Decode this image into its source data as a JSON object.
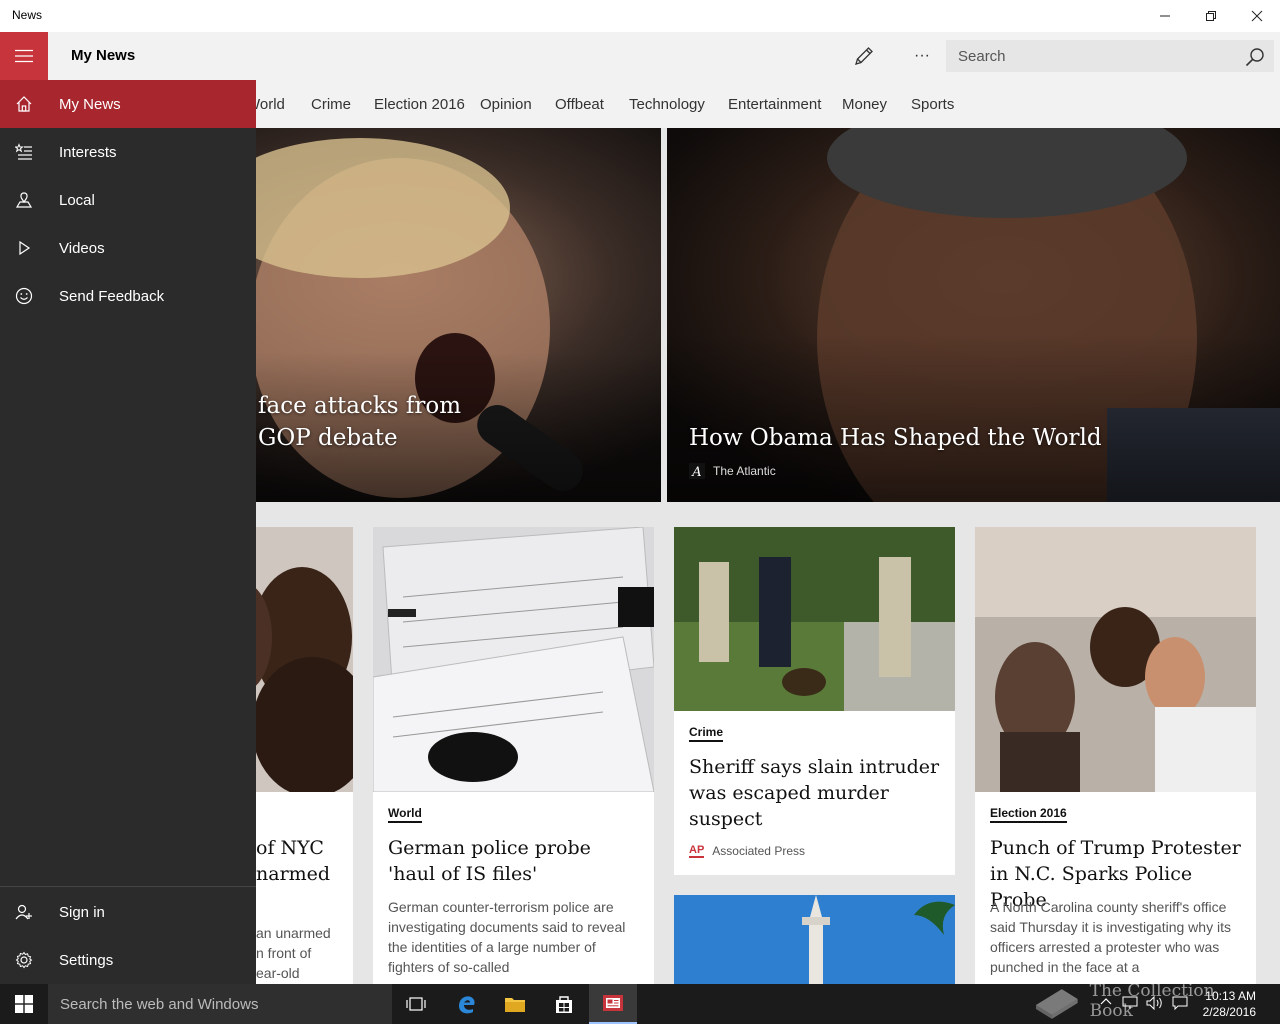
{
  "window": {
    "title": "News"
  },
  "header": {
    "app_title": "My News",
    "search_placeholder": "Search",
    "more_label": "···"
  },
  "tabs": [
    {
      "label": "World"
    },
    {
      "label": "Crime"
    },
    {
      "label": "Election 2016"
    },
    {
      "label": "Opinion"
    },
    {
      "label": "Offbeat"
    },
    {
      "label": "Technology"
    },
    {
      "label": "Entertainment"
    },
    {
      "label": "Money"
    },
    {
      "label": "Sports"
    }
  ],
  "nav": {
    "items": [
      {
        "label": "My News",
        "icon": "home-icon"
      },
      {
        "label": "Interests",
        "icon": "interests-icon"
      },
      {
        "label": "Local",
        "icon": "local-icon"
      },
      {
        "label": "Videos",
        "icon": "play-icon"
      },
      {
        "label": "Send Feedback",
        "icon": "smiley-icon"
      }
    ],
    "bottom": [
      {
        "label": "Sign in",
        "icon": "add-user-icon"
      },
      {
        "label": "Settings",
        "icon": "gear-icon"
      }
    ],
    "accent": "#a8262e"
  },
  "heroes": [
    {
      "headline_line1": "face attacks from",
      "headline_line2": "GOP debate"
    },
    {
      "headline": "How Obama Has Shaped the World",
      "source": "The Atlantic"
    }
  ],
  "cards": [
    {
      "headline_line1": "of NYC",
      "headline_line2": "narmed",
      "summary_line1": "an unarmed",
      "summary_line2": "n front of",
      "summary_line3": "ear-old"
    },
    {
      "category": "World",
      "headline": "German police probe 'haul of IS files'",
      "summary": "German counter-terrorism police are investigating documents said to reveal the identities of a large number of fighters of so-called"
    },
    {
      "category": "Crime",
      "headline": "Sheriff says slain intruder was escaped murder suspect",
      "source": "Associated Press",
      "source_logo": "AP"
    },
    {
      "category": "Election 2016",
      "headline": "Punch of Trump Protester in N.C. Sparks Police Probe",
      "summary": "A North Carolina county sheriff's office said Thursday it is investigating why its officers arrested a protester who was punched in the face at a"
    }
  ],
  "taskbar": {
    "search_placeholder": "Search the web and Windows",
    "time": "10:13 AM",
    "date": "2/28/2016"
  },
  "watermark": "The Collection Book",
  "colors": {
    "brand_red": "#c8343b",
    "nav_bg": "#2b2b2b",
    "taskbar_bg": "#1b1b1b"
  }
}
